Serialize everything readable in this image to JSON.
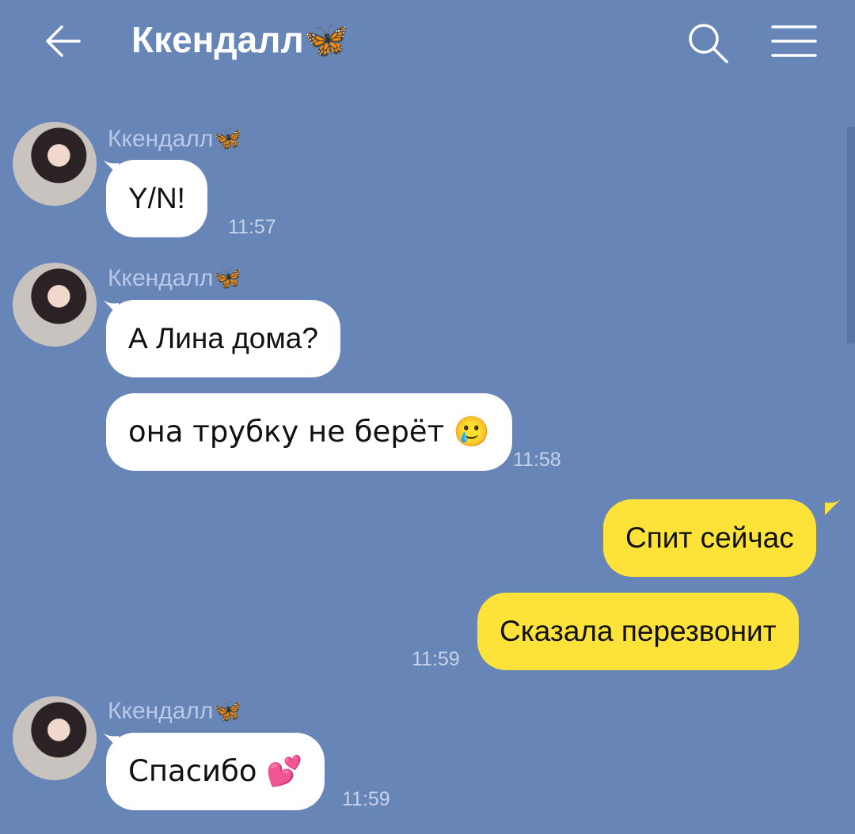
{
  "header": {
    "title": "Ккендалл🦋",
    "back_icon": "back-arrow-icon",
    "search_icon": "search-icon",
    "menu_icon": "menu-icon"
  },
  "colors": {
    "background": "#6885b8",
    "incoming_bubble": "#ffffff",
    "outgoing_bubble": "#fde23a",
    "sender_name": "#b9c9e7",
    "timestamp": "#c5d2ea"
  },
  "messages": [
    {
      "sender": "Ккендалл🦋",
      "text": "Y/N!",
      "time": "11:57",
      "direction": "incoming"
    },
    {
      "sender": "Ккендалл🦋",
      "text": "А Лина дома?",
      "time": "",
      "direction": "incoming"
    },
    {
      "sender": "",
      "text": "она трубку не берёт 🥲",
      "time": "11:58",
      "direction": "incoming"
    },
    {
      "sender": "",
      "text": "Спит сейчас",
      "time": "",
      "direction": "outgoing"
    },
    {
      "sender": "",
      "text": "Сказала перезвонит",
      "time": "11:59",
      "direction": "outgoing"
    },
    {
      "sender": "Ккендалл🦋",
      "text": "Спасибо 💕",
      "time": "11:59",
      "direction": "incoming"
    }
  ]
}
